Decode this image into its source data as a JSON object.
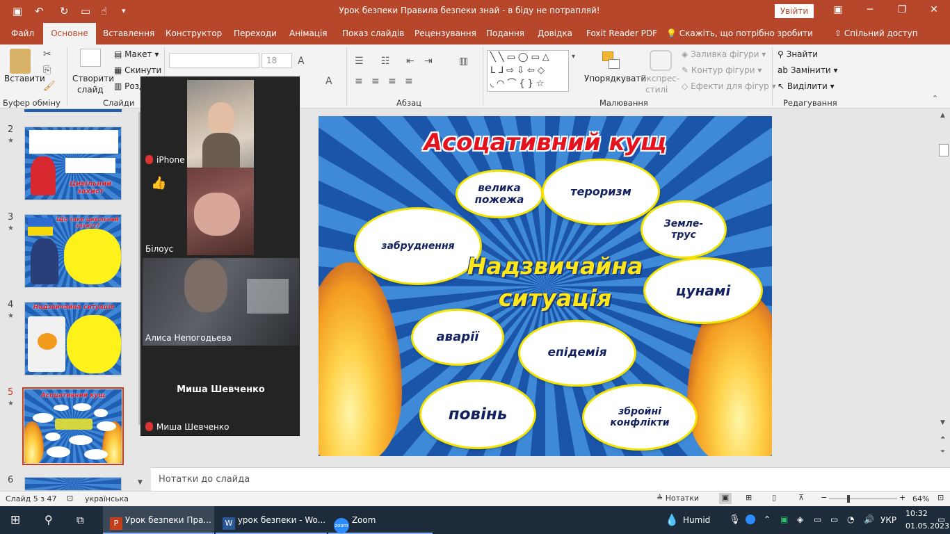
{
  "titlebar": {
    "title": "Урок безпеки Правила безпеки знай - в біду не потрапляй!",
    "login": "Увійти"
  },
  "tabs": [
    "Файл",
    "Основне",
    "Вставлення",
    "Конструктор",
    "Переходи",
    "Анімація",
    "Показ слайдів",
    "Рецензування",
    "Подання",
    "Довідка",
    "Foxit Reader PDF"
  ],
  "tell_me": "Скажіть, що потрібно зробити",
  "share": "Спільний доступ",
  "ribbon": {
    "paste": "Вставити",
    "clipboard_group": "Буфер обміну",
    "new_slide_1": "Створити",
    "new_slide_2": "слайд",
    "layout": "Макет",
    "reset": "Скинути",
    "section": "Розділ",
    "slides_group": "Слайди",
    "font_size": "18",
    "paragraph_group": "Абзац",
    "drawing_group": "Малювання",
    "arrange": "Упорядкувати",
    "quick_styles_1": "Експрес-",
    "quick_styles_2": "стилі",
    "shape_fill": "Заливка фігури",
    "shape_outline": "Контур фігури",
    "shape_effects": "Ефекти для фігур",
    "find": "Знайти",
    "replace": "Замінити",
    "select": "Виділити",
    "editing_group": "Редагування"
  },
  "thumbnails": [
    {
      "num": "2",
      "caption": "Цивільний захист"
    },
    {
      "num": "3",
      "caption": "Що таке цивільний захист?"
    },
    {
      "num": "4",
      "caption": "Надзвичайна ситуація"
    },
    {
      "num": "5",
      "caption": "Асоцативний кущ"
    },
    {
      "num": "6",
      "caption": ""
    }
  ],
  "zoom": {
    "p1_name": "iPhone",
    "p2_name": "Білоус",
    "p2_reaction": "👍",
    "p3_name": "Алиса Непогодьева",
    "p4_center": "Миша Шевченко",
    "p4_name": "Миша Шевченко"
  },
  "slide": {
    "title": "Асоцативний кущ",
    "center_1": "Надзвичайна",
    "center_2": "ситуація",
    "clouds": {
      "fire": "велика пожежа",
      "terror": "тероризм",
      "quake": "Земле- трус",
      "pollution": "забруднення",
      "tsunami": "цунамі",
      "accidents": "аварії",
      "epidemic": "епідемія",
      "flood": "повінь",
      "conflicts": "збройні конфлікти"
    }
  },
  "notes_placeholder": "Нотатки до слайда",
  "status": {
    "slide_of": "Слайд 5 з 47",
    "language": "українська",
    "notes_btn": "Нотатки",
    "zoom_level": "64%"
  },
  "taskbar": {
    "app1": "Урок безпеки Пра...",
    "app2": "урок безпеки - Wo...",
    "app3": "Zoom",
    "weather": "Humid",
    "lang": "УКР",
    "time": "10:32",
    "date": "01.05.2023"
  }
}
